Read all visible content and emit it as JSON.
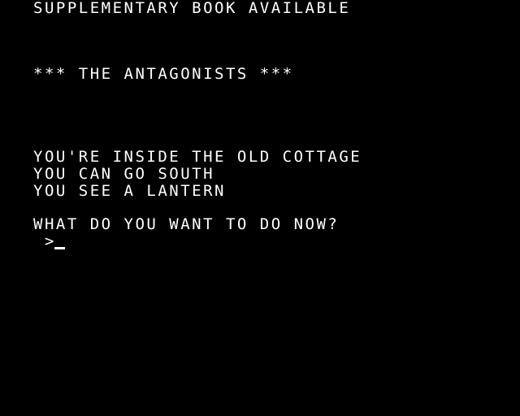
{
  "banner": "SUPPLEMENTARY BOOK AVAILABLE",
  "game_title": "*** THE ANTAGONISTS ***",
  "room": {
    "description": "YOU'RE INSIDE THE OLD COTTAGE",
    "exits": "YOU CAN GO SOUTH",
    "items": "YOU SEE A LANTERN"
  },
  "prompt": {
    "question": "WHAT DO YOU WANT TO DO NOW?",
    "symbol": ">",
    "input_value": ""
  },
  "colors": {
    "background": "#000000",
    "text": "#ffffff"
  }
}
